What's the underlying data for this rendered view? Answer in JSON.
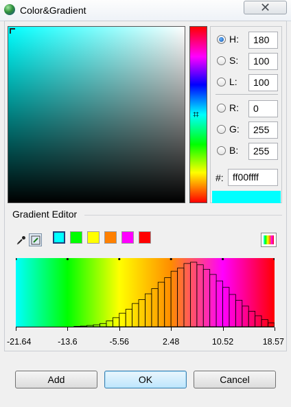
{
  "window": {
    "title": "Color&Gradient"
  },
  "color_picker": {
    "hsl": [
      {
        "label": "H:",
        "value": "180",
        "selected": true
      },
      {
        "label": "S:",
        "value": "100",
        "selected": false
      },
      {
        "label": "L:",
        "value": "100",
        "selected": false
      }
    ],
    "rgb": [
      {
        "label": "R:",
        "value": "0",
        "selected": false
      },
      {
        "label": "G:",
        "value": "255",
        "selected": false
      },
      {
        "label": "B:",
        "value": "255",
        "selected": false
      }
    ],
    "hex_label": "#:",
    "hex_value": "ff00ffff",
    "preview_color": "#00ffff"
  },
  "gradient_editor": {
    "title": "Gradient Editor",
    "tools": [
      "eyedropper-icon",
      "edit-stop-icon"
    ],
    "swatches": [
      "#00ffff",
      "#00ff00",
      "#ffff00",
      "#ff8000",
      "#ff00ff",
      "#ff0000"
    ],
    "gradient_colors": [
      "#00ffff",
      "#00ff00",
      "#ffff00",
      "#ff8c00",
      "#ff00ff",
      "#ff0000"
    ]
  },
  "chart_data": {
    "type": "bar",
    "xlim": [
      -21.64,
      18.57
    ],
    "ticks": [
      "-21.64",
      "-13.6",
      "-5.56",
      "2.48",
      "10.52",
      "18.57"
    ],
    "bin_width": 1.005,
    "bin_start": -21.64,
    "values": [
      0,
      0,
      0,
      0,
      0,
      0,
      0,
      0,
      0,
      0.5,
      1,
      2,
      3,
      5,
      9,
      14,
      21,
      27,
      36,
      42,
      51,
      59,
      69,
      76,
      86,
      91,
      98,
      100,
      96,
      89,
      81,
      71,
      61,
      50,
      41,
      32,
      24,
      17,
      11,
      6
    ]
  },
  "buttons": {
    "add": "Add",
    "ok": "OK",
    "cancel": "Cancel"
  }
}
